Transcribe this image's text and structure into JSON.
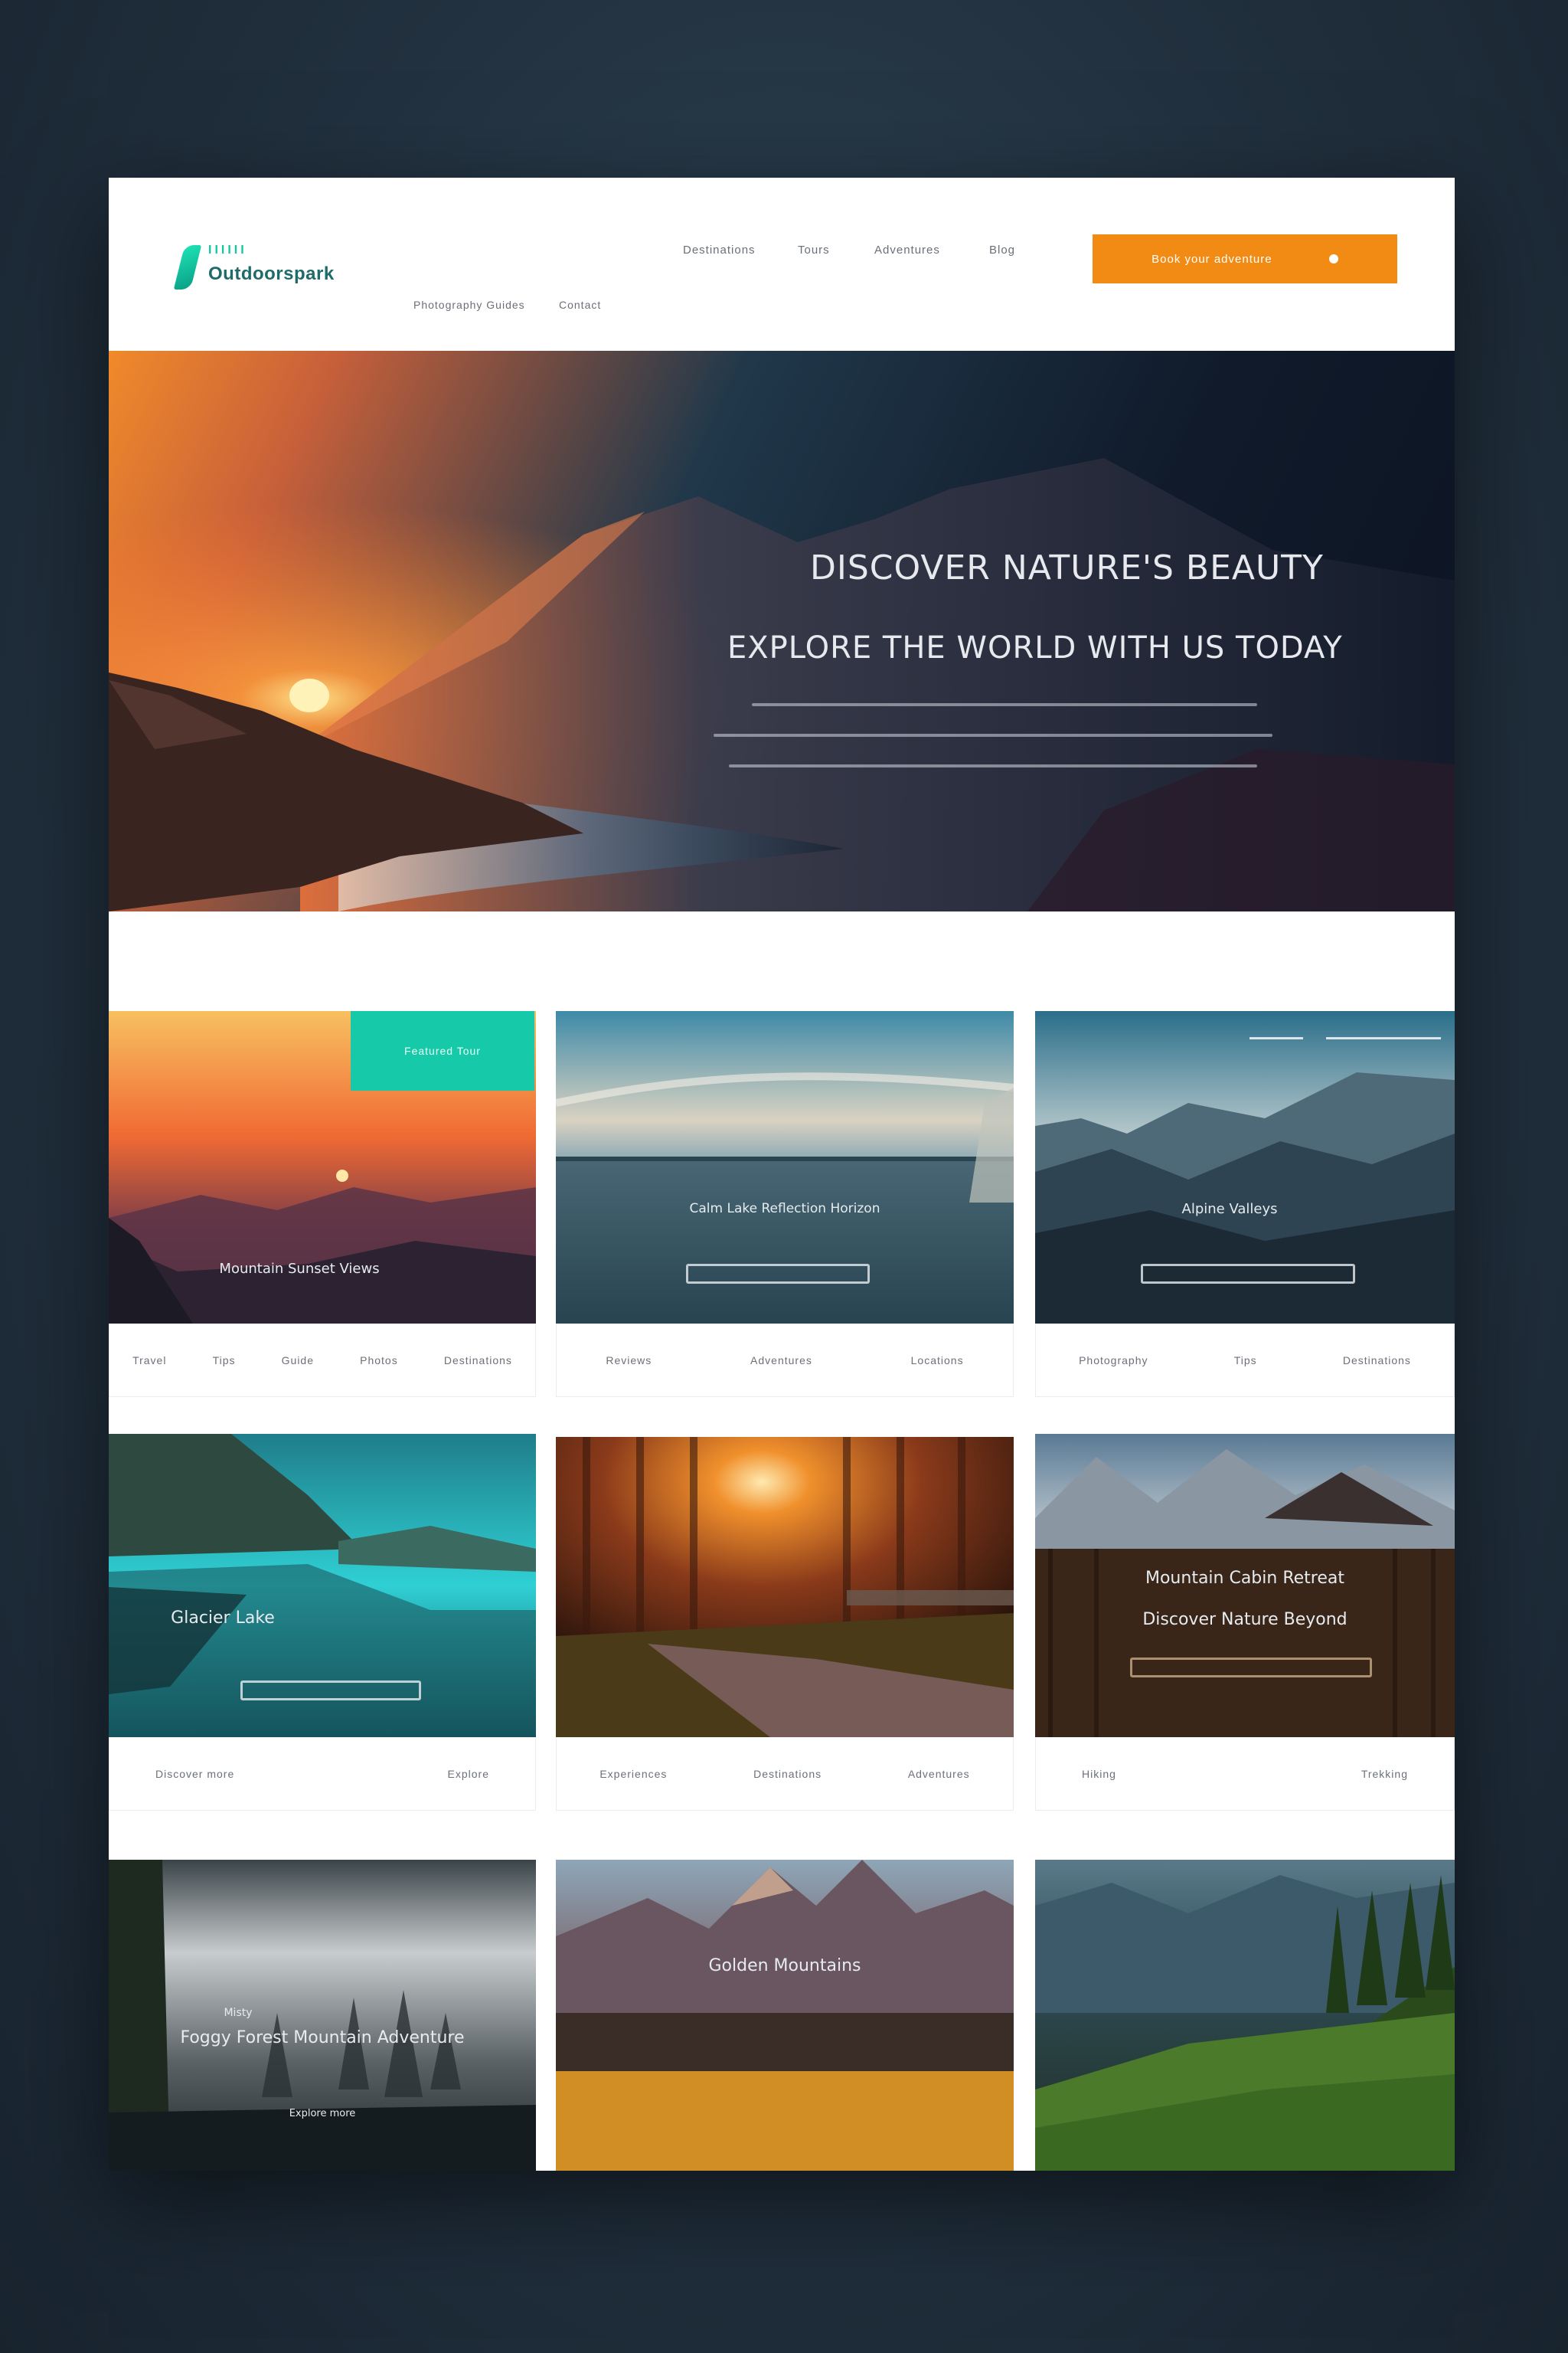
{
  "header": {
    "logo_top": "IIIIII",
    "logo_name": "Outdoorspark",
    "nav": [
      "Destinations",
      "Tours",
      "Adventures",
      "Blog"
    ],
    "subnav": [
      "Photography Guides",
      "Contact"
    ],
    "cta_label": "Book your adventure"
  },
  "hero": {
    "title_line1": "DISCOVER NATURE'S BEAUTY",
    "title_line2": "EXPLORE THE WORLD WITH US TODAY"
  },
  "gallery": {
    "cards": [
      {
        "caption": "Mountain Sunset Views",
        "badge": "Featured Tour",
        "meta": [
          "Travel",
          "Tips",
          "Guide",
          "Photos",
          "Destinations"
        ]
      },
      {
        "caption": "Calm Lake Reflection Horizon",
        "meta": [
          "Reviews",
          "Adventures",
          "Locations"
        ]
      },
      {
        "caption": "Alpine Valleys",
        "meta": [
          "Photography",
          "Tips",
          "Destinations"
        ]
      },
      {
        "caption": "Glacier Lake",
        "meta": [
          "Discover more",
          "Explore"
        ]
      },
      {
        "caption": "",
        "meta": [
          "Experiences",
          "Destinations",
          "Adventures"
        ]
      },
      {
        "caption": "Mountain Cabin Retreat",
        "caption2": "Discover Nature Beyond",
        "meta": [
          "Hiking",
          "Trekking"
        ]
      },
      {
        "caption": "Foggy Forest Mountain Adventure",
        "caption_top": "Misty",
        "caption_sub": "Explore more"
      },
      {
        "caption": "Golden Mountains"
      },
      {
        "caption": ""
      }
    ]
  },
  "colors": {
    "accent_orange": "#f28b14",
    "accent_teal": "#16c9a8",
    "backdrop": "#22313f"
  }
}
